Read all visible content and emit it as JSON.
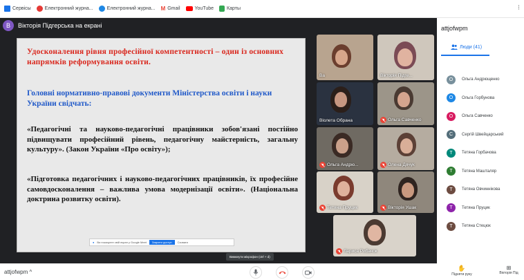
{
  "bookmarks": [
    {
      "label": "Сервісы",
      "color": "#1a73e8"
    },
    {
      "label": "Електронний журна...",
      "color": "#e53935"
    },
    {
      "label": "Електронний журна...",
      "color": "#1e88e5"
    },
    {
      "label": "Gmail",
      "color": "#ea4335"
    },
    {
      "label": "YouTube",
      "color": "#ff0000"
    },
    {
      "label": "Карты",
      "color": "#34a853"
    }
  ],
  "presenter": {
    "initial": "В",
    "label": "Вікторія Підгерська на екрані"
  },
  "slide": {
    "p1": "Удосконалення рівня професійної компетентності – один із основних напрямків реформування освіти.",
    "p2": "Головні нормативно-правові документи Міністерства освіти і науки України свідчать:",
    "p3": "«Педагогічні та науково-педагогічні працівники зобов'язані постійно підвищувати професійний рівень, педагогічну майстерність, загальну культуру». (Закон України «Про освіту»);",
    "p4": "«Підготовка педагогічних і науково-педагогічних працівників, їх професійне самовдосконалення – важлива умова модернізації освіти». (Національна доктрина розвитку освіти).",
    "share_text": "Ви показуєте свій екран у Google Meet",
    "share_button": "Закрити доступ",
    "share_hide": "Сховати"
  },
  "tiles": [
    {
      "name": "Ва",
      "muted": false
    },
    {
      "name": "Вікторія Підге...",
      "muted": false
    },
    {
      "name": "Віолета Обрана",
      "muted": false
    },
    {
      "name": "Ольга Савченко",
      "muted": true
    },
    {
      "name": "Ольга Андрю...",
      "muted": true
    },
    {
      "name": "Олена Дячук",
      "muted": true
    },
    {
      "name": "Тетяна Пруцик",
      "muted": true
    },
    {
      "name": "Вікторія Ушак",
      "muted": true
    },
    {
      "name": "Лариса Рибачок",
      "muted": true
    }
  ],
  "panel": {
    "meeting_code": "attjofwpm",
    "people_tab": "Люди (41)",
    "people": [
      {
        "initial": "О",
        "name": "Ольга Андрющенко",
        "color": "#78909c"
      },
      {
        "initial": "О",
        "name": "Ольга Горбунова",
        "color": "#1e88e5"
      },
      {
        "initial": "О",
        "name": "Ольга Савченко",
        "color": "#d81b60"
      },
      {
        "initial": "С",
        "name": "Сергій Швейцарський",
        "color": "#546e7a"
      },
      {
        "initial": "Т",
        "name": "Тетяна Горбачова",
        "color": "#00897b"
      },
      {
        "initial": "Т",
        "name": "Тетяна Машталяр",
        "color": "#2e7d32"
      },
      {
        "initial": "Т",
        "name": "Тетяна Овчиннікова",
        "color": "#6d4c41"
      },
      {
        "initial": "Т",
        "name": "Тетяна Пруцик",
        "color": "#8e24aa"
      },
      {
        "initial": "Т",
        "name": "Тетяна Стецюк",
        "color": "#6d4c41"
      }
    ]
  },
  "bottom": {
    "meeting_code": "attjofwpm ^",
    "tooltip": "Вимкнути мікрофон (ctrl + d)",
    "raise_hand": "Підняти руку",
    "presenting": "Вікторія Під"
  }
}
